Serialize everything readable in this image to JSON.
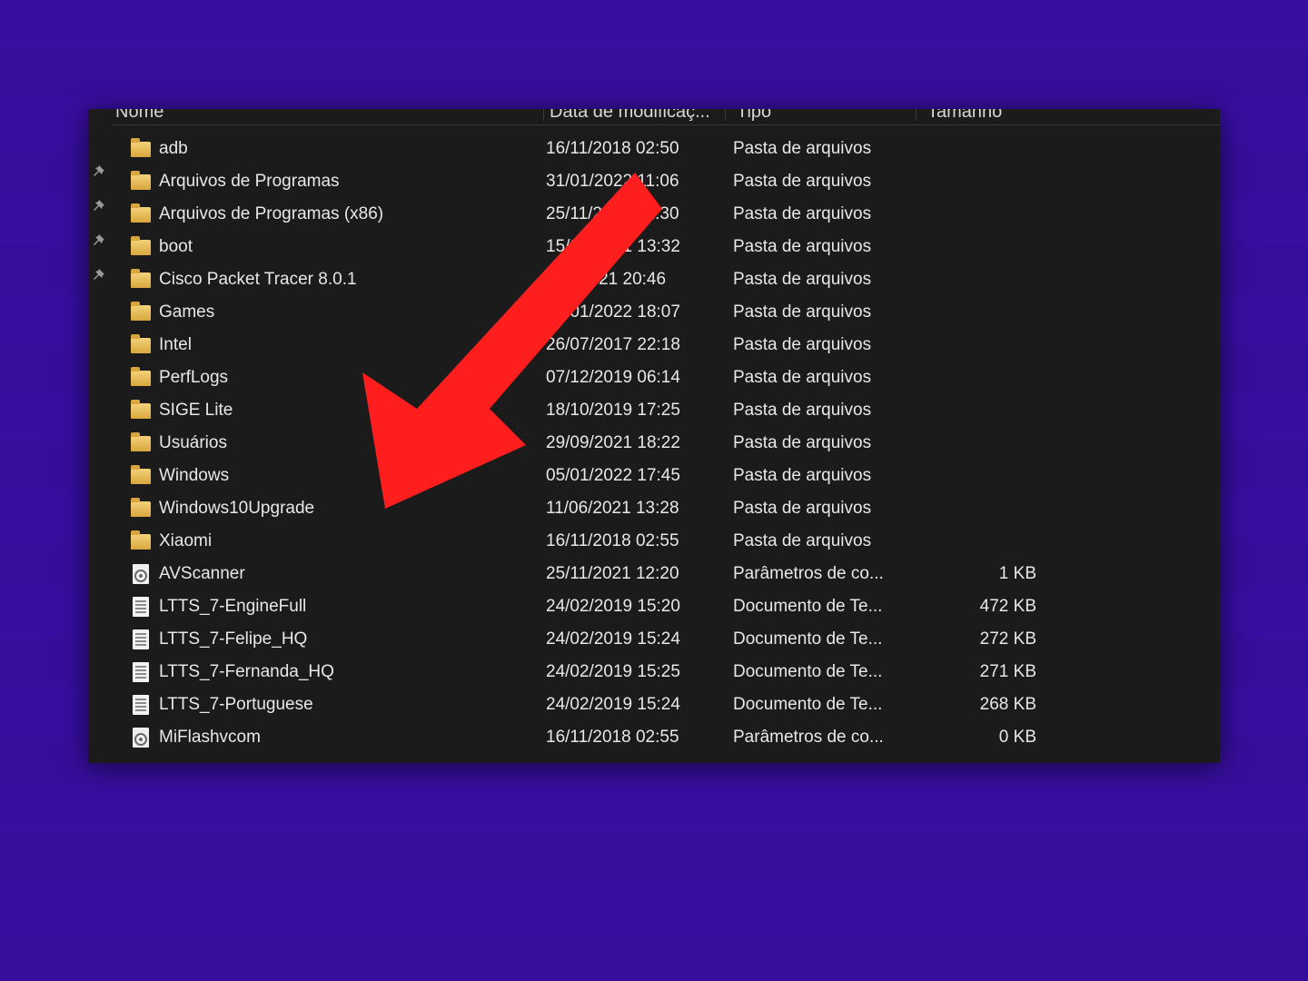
{
  "columns": {
    "name": "Nome",
    "date": "Data de modificaç...",
    "type": "Tipo",
    "size": "Tamanho"
  },
  "files": [
    {
      "icon": "folder",
      "name": "adb",
      "date": "16/11/2018 02:50",
      "type": "Pasta de arquivos",
      "size": ""
    },
    {
      "icon": "folder",
      "name": "Arquivos de Programas",
      "date": "31/01/2022 11:06",
      "type": "Pasta de arquivos",
      "size": ""
    },
    {
      "icon": "folder",
      "name": "Arquivos de Programas (x86)",
      "date": "25/11/2021 12:30",
      "type": "Pasta de arquivos",
      "size": ""
    },
    {
      "icon": "folder",
      "name": "boot",
      "date": "15/03/2021 13:32",
      "type": "Pasta de arquivos",
      "size": ""
    },
    {
      "icon": "folder",
      "name": "Cisco Packet Tracer 8.0.1",
      "date": "19/  /2021 20:46",
      "type": "Pasta de arquivos",
      "size": ""
    },
    {
      "icon": "folder",
      "name": "Games",
      "date": "29/01/2022 18:07",
      "type": "Pasta de arquivos",
      "size": ""
    },
    {
      "icon": "folder",
      "name": "Intel",
      "date": "26/07/2017 22:18",
      "type": "Pasta de arquivos",
      "size": ""
    },
    {
      "icon": "folder",
      "name": "PerfLogs",
      "date": "07/12/2019 06:14",
      "type": "Pasta de arquivos",
      "size": ""
    },
    {
      "icon": "folder",
      "name": "SIGE Lite",
      "date": "18/10/2019 17:25",
      "type": "Pasta de arquivos",
      "size": ""
    },
    {
      "icon": "folder",
      "name": "Usuários",
      "date": "29/09/2021 18:22",
      "type": "Pasta de arquivos",
      "size": ""
    },
    {
      "icon": "folder",
      "name": "Windows",
      "date": "05/01/2022 17:45",
      "type": "Pasta de arquivos",
      "size": ""
    },
    {
      "icon": "folder",
      "name": "Windows10Upgrade",
      "date": "11/06/2021 13:28",
      "type": "Pasta de arquivos",
      "size": ""
    },
    {
      "icon": "folder",
      "name": "Xiaomi",
      "date": "16/11/2018 02:55",
      "type": "Pasta de arquivos",
      "size": ""
    },
    {
      "icon": "ini",
      "name": "AVScanner",
      "date": "25/11/2021 12:20",
      "type": "Parâmetros de co...",
      "size": "1 KB"
    },
    {
      "icon": "txt",
      "name": "LTTS_7-EngineFull",
      "date": "24/02/2019 15:20",
      "type": "Documento de Te...",
      "size": "472 KB"
    },
    {
      "icon": "txt",
      "name": "LTTS_7-Felipe_HQ",
      "date": "24/02/2019 15:24",
      "type": "Documento de Te...",
      "size": "272 KB"
    },
    {
      "icon": "txt",
      "name": "LTTS_7-Fernanda_HQ",
      "date": "24/02/2019 15:25",
      "type": "Documento de Te...",
      "size": "271 KB"
    },
    {
      "icon": "txt",
      "name": "LTTS_7-Portuguese",
      "date": "24/02/2019 15:24",
      "type": "Documento de Te...",
      "size": "268 KB"
    },
    {
      "icon": "ini",
      "name": "MiFlashvcom",
      "date": "16/11/2018 02:55",
      "type": "Parâmetros de co...",
      "size": "0 KB"
    }
  ],
  "pins": [
    62,
    100,
    138,
    176
  ],
  "annotation": {
    "target_index": 10,
    "color": "#ff1e1e"
  }
}
